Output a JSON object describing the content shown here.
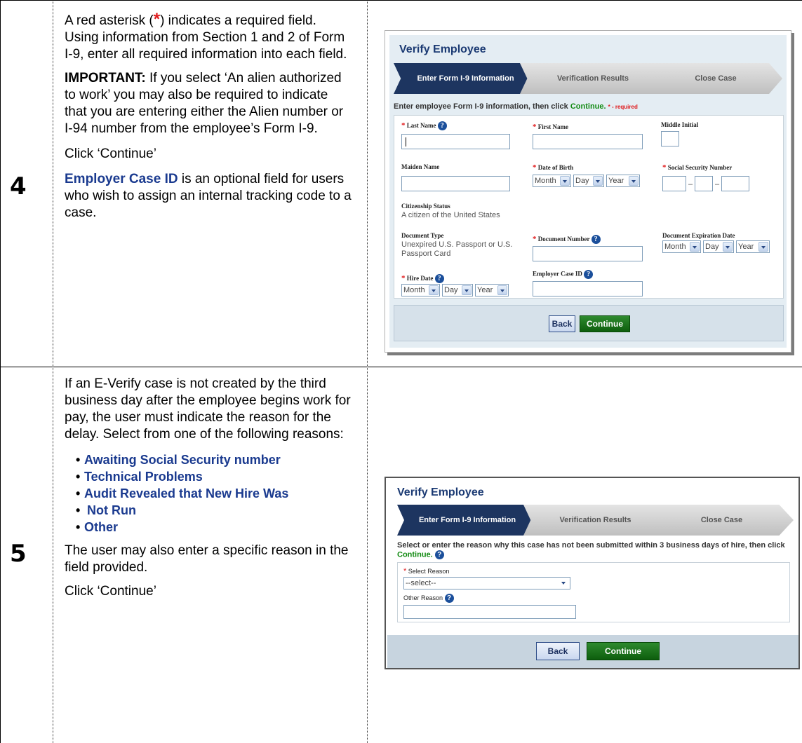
{
  "rows": [
    {
      "step": "4",
      "intro": "A red asterisk (",
      "intro_star": "*",
      "intro_rest": ") indicates a required field. Using information from Section 1 and 2 of Form I-9, enter all required information into each field.",
      "important_label": "IMPORTANT:",
      "important_text": " If you select ‘An alien authorized to work’ you may also be required to indicate that you are entering either the Alien number or I-94 number from the employee’s Form I-9.",
      "click": "Click ‘Continue’",
      "note_label": "Employer Case ID",
      "note_text": " is an optional field for users who wish to assign an internal tracking code to a case."
    },
    {
      "step": "5",
      "intro": "If an E-Verify case is not created by the third business day after the employee begins work for pay, the user must indicate the reason for the delay. Select from one of the following reasons:",
      "reasons": [
        "Awaiting Social Security number",
        "Technical Problems",
        "Audit Revealed that New Hire Was",
        "Not Run",
        "Other"
      ],
      "outro": "The user may also enter a specific reason in the field provided.",
      "click": "Click ‘Continue’"
    }
  ],
  "screen1": {
    "title": "Verify Employee",
    "steps": [
      "Enter Form I-9 Information",
      "Verification Results",
      "Close Case"
    ],
    "instruction_a": "Enter employee Form I-9 information, then click ",
    "instruction_continue": "Continue.",
    "required_note": "* - required",
    "fields": {
      "last_name": "Last Name",
      "first_name": "First Name",
      "middle_initial": "Middle Initial",
      "maiden_name": "Maiden Name",
      "dob": "Date of Birth",
      "ssn": "Social Security Number",
      "citizenship_label": "Citizenship Status",
      "citizenship_value": "A citizen of the United States",
      "doc_type_label": "Document Type",
      "doc_type_value": "Unexpired U.S. Passport or U.S. Passport Card",
      "doc_number": "Document Number",
      "doc_exp": "Document Expiration Date",
      "hire_date": "Hire Date",
      "employer_case_id": "Employer Case ID"
    },
    "selects": {
      "month": "Month",
      "day": "Day",
      "year": "Year"
    },
    "back": "Back",
    "continue": "Continue"
  },
  "screen2": {
    "title": "Verify Employee",
    "steps": [
      "Enter Form I-9 Information",
      "Verification Results",
      "Close Case"
    ],
    "instruction_a": "Select or enter the reason why this case has not been submitted within 3 business days of hire, then click ",
    "instruction_continue": "Continue.",
    "select_reason_label": "Select Reason",
    "select_reason_value": "--select--",
    "other_reason_label": "Other Reason",
    "back": "Back",
    "continue": "Continue"
  },
  "icons": {
    "help": "?",
    "required": "*"
  },
  "colors": {
    "required_red": "#e0191b",
    "link_blue": "#1a3a8f",
    "nav_dark": "#1d3560",
    "continue_green": "#118a11"
  }
}
